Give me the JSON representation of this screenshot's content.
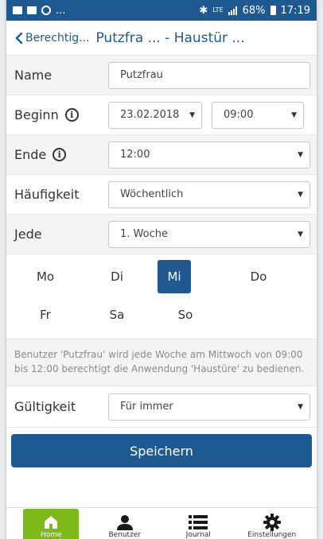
{
  "statusbar": {
    "battery": "68%",
    "time": "17:19",
    "lte": "LTE",
    "left_dots": "..."
  },
  "header": {
    "back_label": "Berechtig...",
    "title": "Putzfra ... - Haustür ..."
  },
  "form": {
    "name": {
      "label": "Name",
      "value": "Putzfrau"
    },
    "beginn": {
      "label": "Beginn",
      "date": "23.02.2018",
      "time": "09:00"
    },
    "ende": {
      "label": "Ende",
      "time": "12:00"
    },
    "haeufigkeit": {
      "label": "Häufigkeit",
      "value": "Wöchentlich"
    },
    "jede": {
      "label": "Jede",
      "value": "1. Woche"
    },
    "days": [
      "Mo",
      "Di",
      "Mi",
      "Do",
      "Fr",
      "Sa",
      "So"
    ],
    "selected_day": "Mi",
    "description": "Benutzer 'Putzfrau' wird jede Woche am Mittwoch von 09:00 bis 12:00 berechtigt die Anwendung 'Haustüre' zu bedienen.",
    "gueltigkeit": {
      "label": "Gültigkeit",
      "value": "Für immer"
    },
    "save_label": "Speichern"
  },
  "nav": [
    {
      "label": "Home",
      "icon": "home-icon",
      "active": true
    },
    {
      "label": "Benutzer",
      "icon": "user-icon",
      "active": false
    },
    {
      "label": "Journal",
      "icon": "list-icon",
      "active": false
    },
    {
      "label": "Einstellungen",
      "icon": "gear-icon",
      "active": false
    }
  ],
  "colors": {
    "primary": "#1e5a91",
    "active_nav": "#7cb919"
  }
}
